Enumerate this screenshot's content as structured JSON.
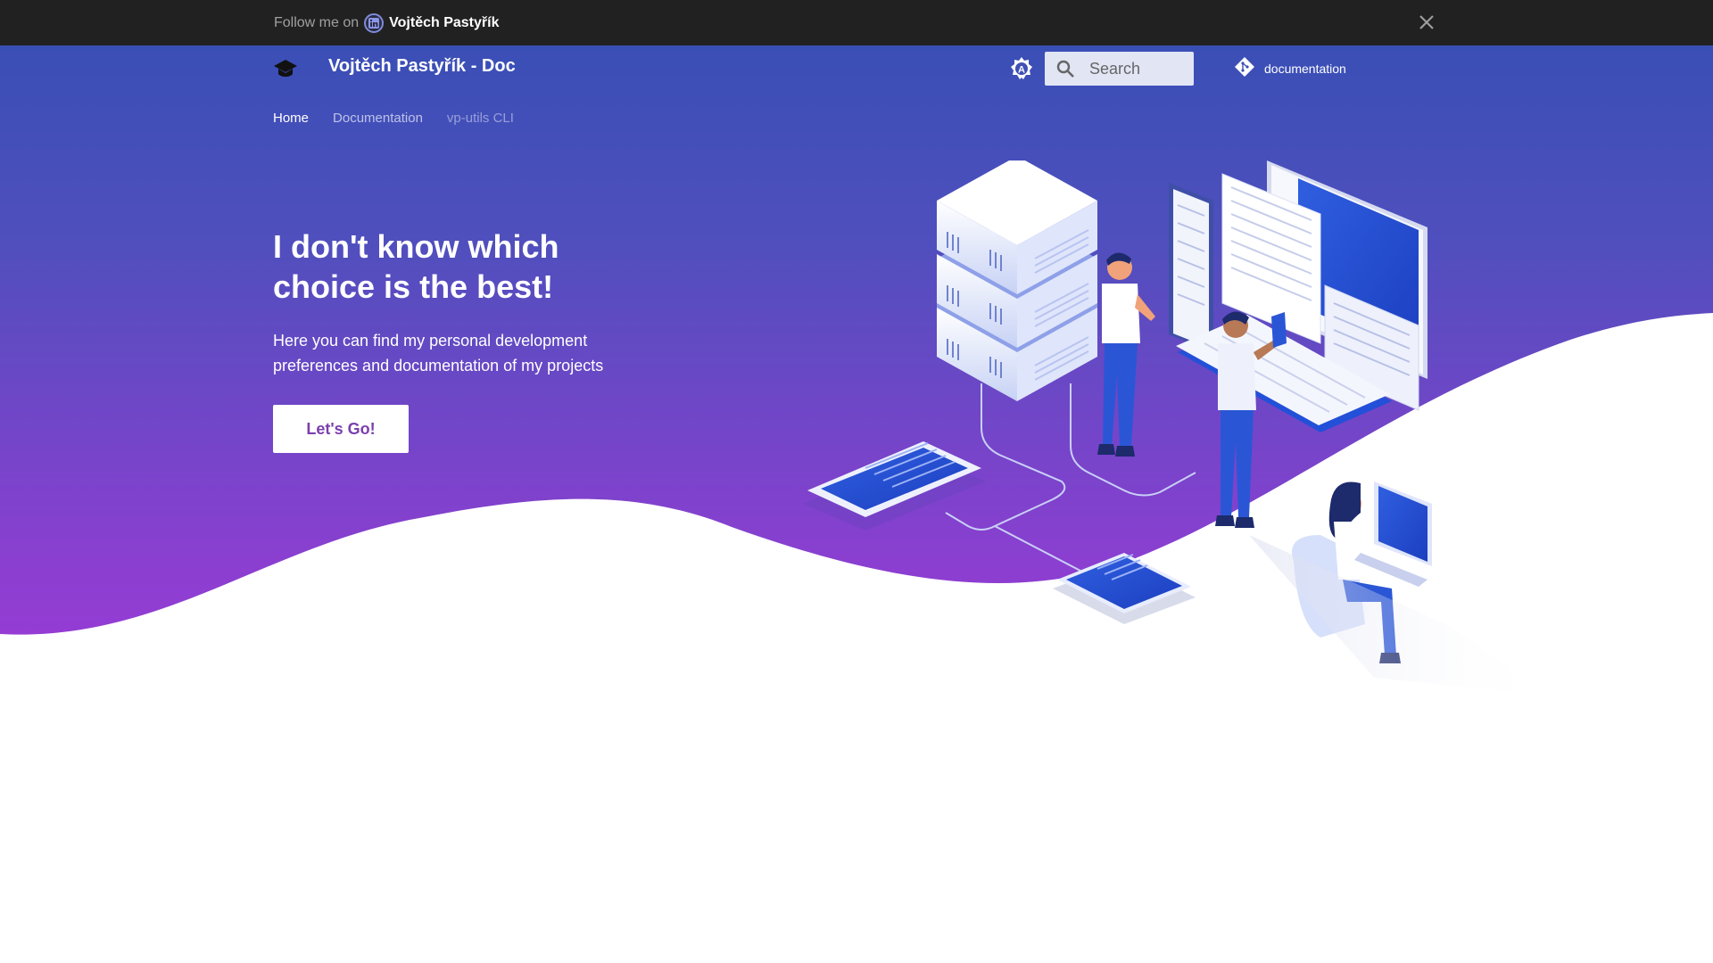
{
  "announcement": {
    "prefix": "Follow me on",
    "name": "Vojtěch Pastyřík",
    "icons": {
      "social": "linkedin-icon",
      "close": "close-icon"
    }
  },
  "header": {
    "title": "Vojtěch Pastyřík - Doc",
    "logo_icon": "graduation-cap-icon",
    "palette_icon": "brightness-auto-icon",
    "search_placeholder": "Search",
    "repo_label": "documentation",
    "repo_icon": "git-icon"
  },
  "tabs": [
    {
      "label": "Home",
      "active": true
    },
    {
      "label": "Documentation",
      "active": false
    },
    {
      "label": "vp-utils CLI",
      "active": false
    }
  ],
  "hero": {
    "headline": "I don't know which choice is the best!",
    "subtext": "Here you can find my personal development preferences and documentation of my projects",
    "cta_label": "Let's Go!",
    "illustration": "isometric-servers-developers-illustration"
  },
  "colors": {
    "announce_bg": "#212121",
    "hero_top": "#3a4fb6",
    "hero_bottom": "#9b3ad6",
    "cta_text": "#7b3fae"
  }
}
